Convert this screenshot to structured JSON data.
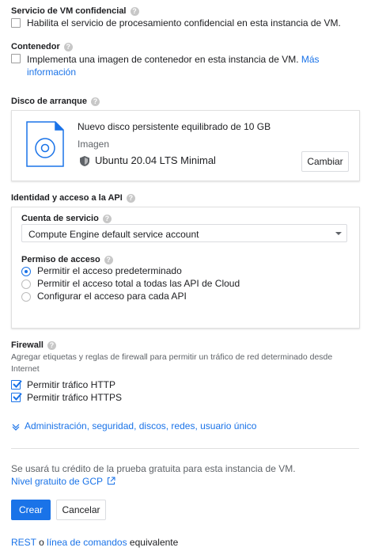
{
  "confidential": {
    "title": "Servicio de VM confidencial",
    "label": "Habilita el servicio de procesamiento confidencial en esta instancia de VM."
  },
  "container": {
    "title": "Contenedor",
    "label": "Implementa una imagen de contenedor en esta instancia de VM.",
    "link_line1": "Más",
    "link_line2": "información"
  },
  "boot_disk": {
    "title": "Disco de arranque",
    "disk_name": "Nuevo disco persistente equilibrado de 10 GB",
    "image_label": "Imagen",
    "image_value": "Ubuntu 20.04 LTS Minimal",
    "change_button": "Cambiar"
  },
  "identity": {
    "title": "Identidad y acceso a la API",
    "service_account_title": "Cuenta de servicio",
    "service_account_value": "Compute Engine default service account",
    "access_title": "Permiso de acceso",
    "options": [
      {
        "label": "Permitir el acceso predeterminado",
        "selected": true
      },
      {
        "label": "Permitir el acceso total a todas las API de Cloud",
        "selected": false
      },
      {
        "label": "Configurar el acceso para cada API",
        "selected": false
      }
    ]
  },
  "firewall": {
    "title": "Firewall",
    "description_line1": "Agregar etiquetas y reglas de firewall para permitir un tráfico de red determinado desde",
    "description_line2": "Internet",
    "http_label": "Permitir tráfico HTTP",
    "https_label": "Permitir tráfico HTTPS",
    "http_checked": true,
    "https_checked": true
  },
  "advanced_link": "Administración, seguridad, discos, redes, usuario único",
  "free_trial": {
    "text": "Se usará tu crédito de la prueba gratuita para esta instancia de VM.",
    "link": "Nivel gratuito de GCP"
  },
  "actions": {
    "create": "Crear",
    "cancel": "Cancelar"
  },
  "footer": {
    "rest": "REST",
    "or": "o",
    "command_line": "línea de comandos",
    "equivalent": "equivalente"
  },
  "colors": {
    "accent": "#1a73e8",
    "text": "#202124",
    "secondary": "#5f6368"
  }
}
